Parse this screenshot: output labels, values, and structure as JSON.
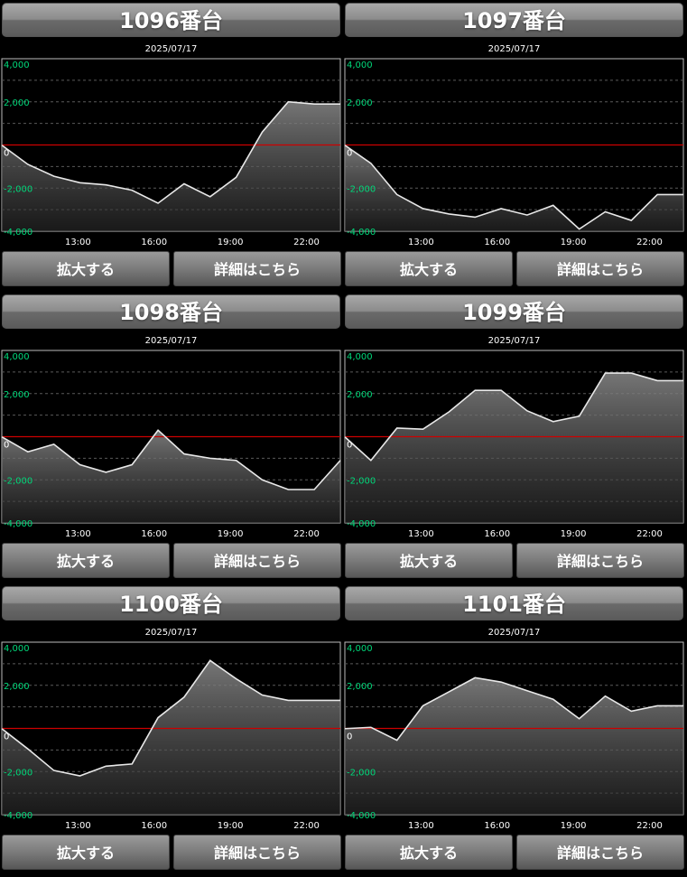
{
  "buttons": {
    "zoom_label": "拡大する",
    "detail_label": "詳細はこちら"
  },
  "colors": {
    "zero_line": "#cc0000",
    "y_tick": "#00d87a",
    "x_tick": "#ffffff",
    "line": "#e8e8e8"
  },
  "machines": [
    {
      "title": "1096番台",
      "date": "2025/07/17"
    },
    {
      "title": "1097番台",
      "date": "2025/07/17"
    },
    {
      "title": "1098番台",
      "date": "2025/07/17"
    },
    {
      "title": "1099番台",
      "date": "2025/07/17"
    },
    {
      "title": "1100番台",
      "date": "2025/07/17"
    },
    {
      "title": "1101番台",
      "date": "2025/07/17"
    }
  ],
  "chart_data": [
    {
      "type": "area",
      "title": "1096番台",
      "x_ticks": [
        "13:00",
        "16:00",
        "19:00",
        "22:00"
      ],
      "y_ticks": [
        "4,000",
        "2,000",
        "0",
        "-2,000",
        "-4,000"
      ],
      "ylim": [
        -4000,
        4000
      ],
      "grid": true,
      "series": [
        {
          "values": [
            -10,
            -900,
            -1450,
            -1750,
            -1850,
            -2100,
            -2700,
            -1800,
            -2400,
            -1500,
            600,
            2000,
            1900,
            1900
          ]
        }
      ]
    },
    {
      "type": "area",
      "title": "1097番台",
      "x_ticks": [
        "13:00",
        "16:00",
        "19:00",
        "22:00"
      ],
      "y_ticks": [
        "4,000",
        "2,000",
        "0",
        "-2,000",
        "-4,000"
      ],
      "ylim": [
        -4000,
        4000
      ],
      "grid": true,
      "series": [
        {
          "values": [
            -10,
            -850,
            -2300,
            -2950,
            -3200,
            -3350,
            -2950,
            -3250,
            -2800,
            -3900,
            -3100,
            -3500,
            -2300,
            -2300
          ]
        }
      ]
    },
    {
      "type": "area",
      "title": "1098番台",
      "x_ticks": [
        "13:00",
        "16:00",
        "19:00",
        "22:00"
      ],
      "y_ticks": [
        "4,000",
        "2,000",
        "0",
        "-2,000",
        "-4,000"
      ],
      "ylim": [
        -4000,
        4000
      ],
      "grid": true,
      "series": [
        {
          "values": [
            -10,
            -700,
            -350,
            -1300,
            -1650,
            -1300,
            300,
            -800,
            -1000,
            -1100,
            -2000,
            -2450,
            -2450,
            -1100
          ]
        }
      ]
    },
    {
      "type": "area",
      "title": "1099番台",
      "x_ticks": [
        "13:00",
        "16:00",
        "19:00",
        "22:00"
      ],
      "y_ticks": [
        "4,000",
        "2,000",
        "0",
        "-2,000",
        "-4,000"
      ],
      "ylim": [
        -4000,
        4000
      ],
      "grid": true,
      "series": [
        {
          "values": [
            -10,
            -1100,
            400,
            350,
            1150,
            2150,
            2150,
            1200,
            700,
            950,
            2950,
            2950,
            2600,
            2600
          ]
        }
      ]
    },
    {
      "type": "area",
      "title": "1100番台",
      "x_ticks": [
        "13:00",
        "16:00",
        "19:00",
        "22:00"
      ],
      "y_ticks": [
        "4,000",
        "2,000",
        "0",
        "-2,000",
        "-4,000"
      ],
      "ylim": [
        -4000,
        4000
      ],
      "grid": true,
      "series": [
        {
          "values": [
            -10,
            -950,
            -1950,
            -2200,
            -1750,
            -1650,
            500,
            1450,
            3150,
            2300,
            1550,
            1300,
            1300,
            1300
          ]
        }
      ]
    },
    {
      "type": "area",
      "title": "1101番台",
      "x_ticks": [
        "13:00",
        "16:00",
        "19:00",
        "22:00"
      ],
      "y_ticks": [
        "4,000",
        "2,000",
        "0",
        "-2,000",
        "-4,000"
      ],
      "ylim": [
        -4000,
        4000
      ],
      "grid": true,
      "series": [
        {
          "values": [
            -10,
            50,
            -550,
            1050,
            1700,
            2350,
            2150,
            1750,
            1350,
            450,
            1500,
            800,
            1050,
            1050
          ]
        }
      ]
    }
  ]
}
